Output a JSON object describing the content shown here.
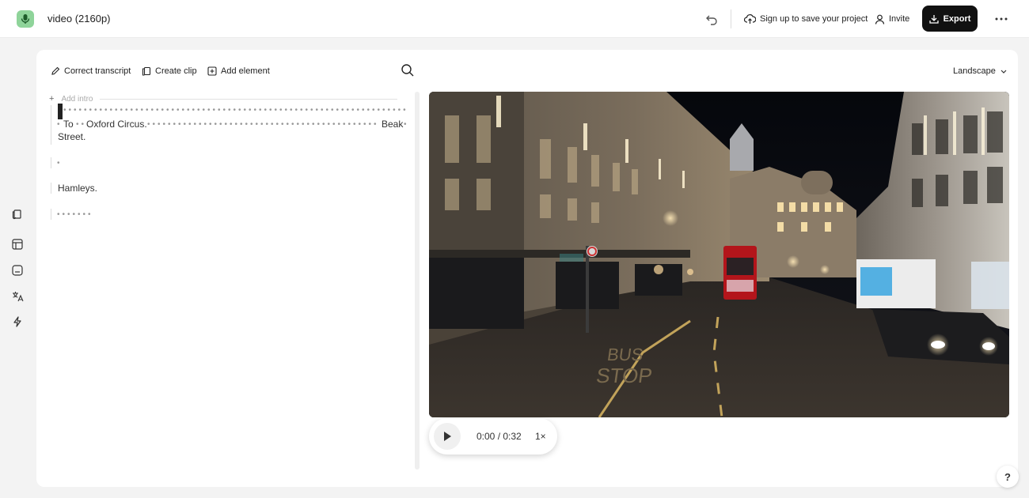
{
  "header": {
    "project_title": "video (2160p)",
    "signup_label": "Sign up to save your project",
    "invite_label": "Invite",
    "export_label": "Export"
  },
  "toolbar": {
    "correct_transcript": "Correct transcript",
    "create_clip": "Create clip",
    "add_element": "Add element",
    "layout_select": "Landscape"
  },
  "transcript": {
    "intro_placeholder": "Add intro",
    "line1_to": "To",
    "line1_place": "Oxford Circus.",
    "line1_end": "Beak",
    "line2": "Street.",
    "line3": "Hamleys."
  },
  "player": {
    "time": "0:00 / 0:32",
    "speed": "1×"
  },
  "help_label": "?",
  "colors": {
    "brand": "#8fd49a",
    "export_bg": "#111111"
  }
}
